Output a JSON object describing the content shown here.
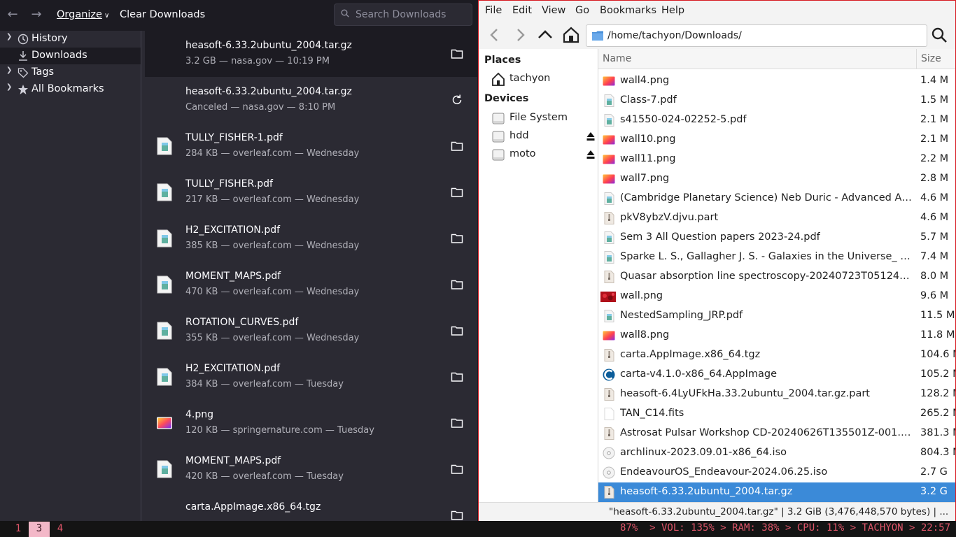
{
  "library": {
    "toolbar": {
      "organize_label": "Organize",
      "clear_label": "Clear Downloads",
      "search_placeholder": "Search Downloads"
    },
    "tree": [
      {
        "label": "History",
        "icon": "history-clock-icon",
        "expandable": true,
        "selected": false
      },
      {
        "label": "Downloads",
        "icon": "download-icon",
        "expandable": false,
        "selected": true
      },
      {
        "label": "Tags",
        "icon": "tag-icon",
        "expandable": true,
        "selected": false
      },
      {
        "label": "All Bookmarks",
        "icon": "star-icon",
        "expandable": true,
        "selected": false
      }
    ],
    "downloads": [
      {
        "name": "heasoft-6.33.2ubuntu_2004.tar.gz",
        "meta": "3.2 GB — nasa.gov — 10:19 PM",
        "type": "archive",
        "action": "folder-icon",
        "selected": true
      },
      {
        "name": "heasoft-6.33.2ubuntu_2004.tar.gz",
        "meta": "Canceled — nasa.gov — 8:10 PM",
        "type": "archive",
        "action": "retry-icon",
        "selected": false
      },
      {
        "name": "TULLY_FISHER-1.pdf",
        "meta": "284 KB — overleaf.com — Wednesday",
        "type": "pdf",
        "action": "folder-icon",
        "selected": false
      },
      {
        "name": "TULLY_FISHER.pdf",
        "meta": "217 KB — overleaf.com — Wednesday",
        "type": "pdf",
        "action": "folder-icon",
        "selected": false
      },
      {
        "name": "H2_EXCITATION.pdf",
        "meta": "385 KB — overleaf.com — Wednesday",
        "type": "pdf",
        "action": "folder-icon",
        "selected": false
      },
      {
        "name": "MOMENT_MAPS.pdf",
        "meta": "470 KB — overleaf.com — Wednesday",
        "type": "pdf",
        "action": "folder-icon",
        "selected": false
      },
      {
        "name": "ROTATION_CURVES.pdf",
        "meta": "355 KB — overleaf.com — Wednesday",
        "type": "pdf",
        "action": "folder-icon",
        "selected": false
      },
      {
        "name": "H2_EXCITATION.pdf",
        "meta": "384 KB — overleaf.com — Tuesday",
        "type": "pdf",
        "action": "folder-icon",
        "selected": false
      },
      {
        "name": "4.png",
        "meta": "120 KB — springernature.com — Tuesday",
        "type": "image",
        "action": "folder-icon",
        "selected": false
      },
      {
        "name": "MOMENT_MAPS.pdf",
        "meta": "420 KB — overleaf.com — Tuesday",
        "type": "pdf",
        "action": "folder-icon",
        "selected": false
      },
      {
        "name": "carta.AppImage.x86_64.tgz",
        "meta": "",
        "type": "archive",
        "action": "folder-icon",
        "selected": false
      }
    ]
  },
  "filemanager": {
    "menu": [
      "File",
      "Edit",
      "View",
      "Go",
      "Bookmarks",
      "Help"
    ],
    "path": "/home/tachyon/Downloads/",
    "sidebar": {
      "places_heading": "Places",
      "places": [
        {
          "label": "tachyon",
          "icon": "home-icon"
        }
      ],
      "devices_heading": "Devices",
      "devices": [
        {
          "label": "File System",
          "icon": "drive-icon",
          "eject": false
        },
        {
          "label": "hdd",
          "icon": "drive-icon",
          "eject": true
        },
        {
          "label": "moto",
          "icon": "drive-icon",
          "eject": true
        }
      ]
    },
    "columns": {
      "name": "Name",
      "size": "Size"
    },
    "files": [
      {
        "name": "wall4.png",
        "size": "1.4 M",
        "type": "image"
      },
      {
        "name": "Class-7.pdf",
        "size": "1.5 M",
        "type": "pdf"
      },
      {
        "name": "s41550-024-02252-5.pdf",
        "size": "2.1 M",
        "type": "pdf"
      },
      {
        "name": "wall10.png",
        "size": "2.1 M",
        "type": "image"
      },
      {
        "name": "wall11.png",
        "size": "2.2 M",
        "type": "image"
      },
      {
        "name": "wall7.png",
        "size": "2.8 M",
        "type": "image"
      },
      {
        "name": "(Cambridge Planetary Science) Neb Duric - Advanced Astrophysics",
        "size": "4.6 M",
        "type": "pdf"
      },
      {
        "name": "pkV8ybzV.djvu.part",
        "size": "4.6 M",
        "type": "archive"
      },
      {
        "name": "Sem 3 All Question papers 2023-24.pdf",
        "size": "5.7 M",
        "type": "pdf"
      },
      {
        "name": "Sparke L. S., Gallagher J. S. - Galaxies in the Universe_ An Introduction",
        "size": "7.4 M",
        "type": "pdf"
      },
      {
        "name": "Quasar absorption line spectroscopy-20240723T051241Z-001.zip",
        "size": "8.0 M",
        "type": "archive"
      },
      {
        "name": "wall.png",
        "size": "9.6 M",
        "type": "image-red"
      },
      {
        "name": "NestedSampling_JRP.pdf",
        "size": "11.5 M",
        "type": "pdf"
      },
      {
        "name": "wall8.png",
        "size": "11.8 M",
        "type": "image"
      },
      {
        "name": "carta.AppImage.x86_64.tgz",
        "size": "104.6 M",
        "type": "archive"
      },
      {
        "name": "carta-v4.1.0-x86_64.AppImage",
        "size": "105.2 M",
        "type": "app"
      },
      {
        "name": "heasoft-6.4LyUFkHa.33.2ubuntu_2004.tar.gz.part",
        "size": "128.2 M",
        "type": "archive"
      },
      {
        "name": "TAN_C14.fits",
        "size": "265.2 M",
        "type": "blank"
      },
      {
        "name": "Astrosat Pulsar Workshop CD-20240626T135501Z-001.zip",
        "size": "381.3 M",
        "type": "archive"
      },
      {
        "name": "archlinux-2023.09.01-x86_64.iso",
        "size": "804.3 M",
        "type": "disc"
      },
      {
        "name": "EndeavourOS_Endeavour-2024.06.25.iso",
        "size": "2.7 G",
        "type": "disc"
      },
      {
        "name": "heasoft-6.33.2ubuntu_2004.tar.gz",
        "size": "3.2 G",
        "type": "archive",
        "selected": true
      }
    ],
    "status": "\"heasoft-6.33.2ubuntu_2004.tar.gz\" | 3.2 GiB (3,476,448,570 bytes) | ..."
  },
  "bar": {
    "workspaces": [
      {
        "label": "1",
        "active": false
      },
      {
        "label": "3",
        "active": true
      },
      {
        "label": "4",
        "active": false
      }
    ],
    "status": "87%  > VOL: 135% > RAM: 38% > CPU: 11% > TACHYON > 22:57"
  },
  "colors": {
    "library_bg": "#2b2a33",
    "library_toolbar": "#1c1b22",
    "fm_selection": "#3b8ad8",
    "bar_text": "#e0566a",
    "workspace_active": "#f3b8c8"
  }
}
